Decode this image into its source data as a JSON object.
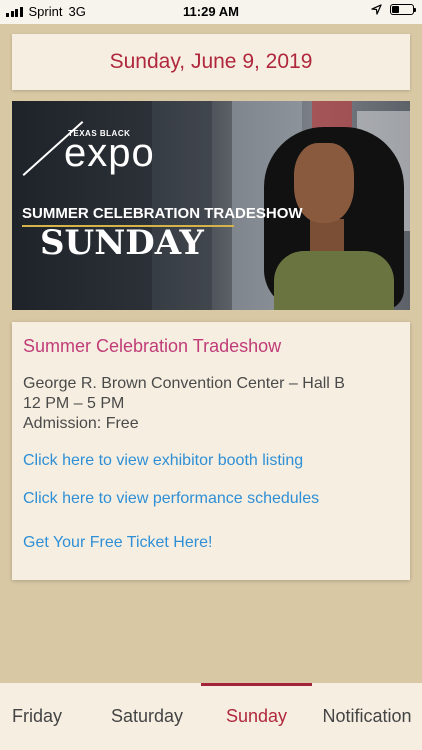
{
  "status_bar": {
    "carrier": "Sprint",
    "network": "3G",
    "time": "11:29 AM",
    "icons": [
      "signal-icon",
      "location-arrow-icon",
      "battery-icon"
    ]
  },
  "date_header": "Sunday, June 9, 2019",
  "banner": {
    "logo_small": "TEXAS BLACK",
    "logo_big": "expo",
    "line1": "SUMMER CELEBRATION TRADESHOW",
    "line2": "SUNDAY"
  },
  "event": {
    "title": "Summer Celebration Tradeshow",
    "location": "George R. Brown Convention Center – Hall B",
    "hours": "12 PM – 5 PM",
    "admission": "Admission: Free",
    "links": [
      "Click here to view exhibitor booth listing",
      "Click here to view performance schedules",
      "Get Your Free Ticket Here!"
    ]
  },
  "tabs": [
    "Friday",
    "Saturday",
    "Sunday",
    "Notification"
  ],
  "active_tab": "Sunday",
  "colors": {
    "background": "#d8c8a4",
    "card": "#f6efe1",
    "date_red": "#b0283d",
    "title_pink": "#c03c78",
    "link_blue": "#2f8fd6"
  }
}
